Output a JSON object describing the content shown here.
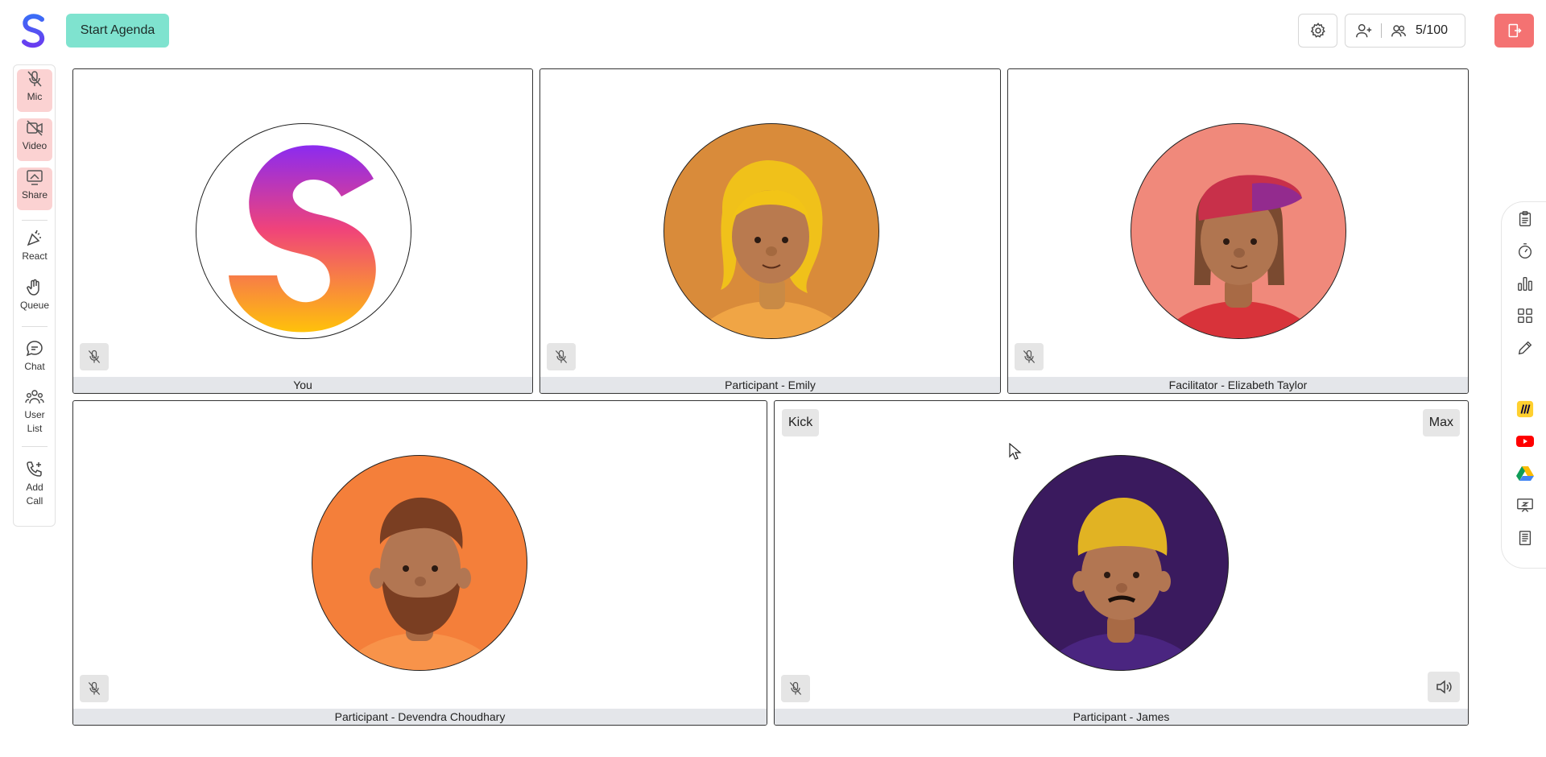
{
  "app": {
    "start_agenda_label": "Start Agenda",
    "participant_count": "5/100",
    "accent_color": "#7fe3cf",
    "danger_color": "#f47272"
  },
  "left_toolbar": {
    "items": [
      {
        "label": "Mic",
        "icon": "mic-off-icon",
        "active": true
      },
      {
        "label": "Video",
        "icon": "video-off-icon",
        "active": true
      },
      {
        "label": "Share",
        "icon": "screen-share-icon",
        "active": true
      },
      {
        "label": "React",
        "icon": "party-popper-icon",
        "active": false
      },
      {
        "label": "Queue",
        "icon": "raised-hand-icon",
        "active": false
      },
      {
        "label": "Chat",
        "icon": "chat-bubble-icon",
        "active": false
      },
      {
        "label": "User List",
        "icon": "users-icon",
        "active": false
      },
      {
        "label": "Add Call",
        "icon": "phone-plus-icon",
        "active": false
      }
    ]
  },
  "tiles": [
    {
      "name": "You",
      "avatar": "logo-avatar",
      "avatar_bg": "#ffffff",
      "muted": true
    },
    {
      "name": "Participant - Emily",
      "avatar": "emily-avatar",
      "avatar_bg": "#d98b3a",
      "muted": true
    },
    {
      "name": "Facilitator - Elizabeth Taylor",
      "avatar": "elizabeth-avatar",
      "avatar_bg": "#f0897b",
      "muted": true
    },
    {
      "name": "Participant - Devendra Choudhary",
      "avatar": "devendra-avatar",
      "avatar_bg": "#f47f3a",
      "muted": true
    },
    {
      "name": "Participant - James",
      "avatar": "james-avatar",
      "avatar_bg": "#3a1a5e",
      "muted": true,
      "kick_label": "Kick",
      "max_label": "Max"
    }
  ],
  "right_toolbar": {
    "items": [
      "clipboard-icon",
      "timer-icon",
      "bar-chart-icon",
      "grid-icon",
      "pencil-icon",
      "miro-icon",
      "youtube-icon",
      "google-drive-icon",
      "whiteboard-icon",
      "document-icon"
    ]
  }
}
